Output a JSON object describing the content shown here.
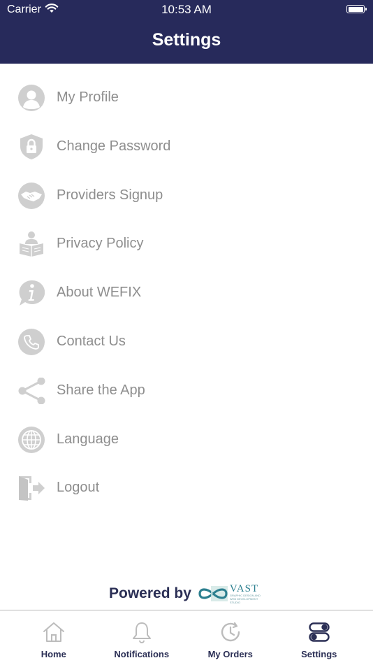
{
  "status_bar": {
    "carrier": "Carrier",
    "time": "10:53 AM"
  },
  "header": {
    "title": "Settings"
  },
  "menu": [
    {
      "label": "My Profile",
      "icon": "profile-icon"
    },
    {
      "label": "Change Password",
      "icon": "lock-shield-icon"
    },
    {
      "label": "Providers Signup",
      "icon": "handshake-icon"
    },
    {
      "label": "Privacy Policy",
      "icon": "reader-icon"
    },
    {
      "label": "About WEFIX",
      "icon": "info-icon"
    },
    {
      "label": "Contact Us",
      "icon": "phone-icon"
    },
    {
      "label": "Share the App",
      "icon": "share-icon"
    },
    {
      "label": "Language",
      "icon": "globe-icon"
    },
    {
      "label": "Logout",
      "icon": "logout-icon"
    }
  ],
  "footer": {
    "powered_by": "Powered by",
    "vast_logo_text": "VAST",
    "vast_tagline": "GRAPHIC DESIGN AND WEB DEVELOPMENT STUDIO"
  },
  "tabbar": {
    "tabs": [
      {
        "label": "Home",
        "icon": "home-icon"
      },
      {
        "label": "Notifications",
        "icon": "bell-icon"
      },
      {
        "label": "My Orders",
        "icon": "orders-clock-icon"
      },
      {
        "label": "Settings",
        "icon": "toggles-icon",
        "active": true
      }
    ]
  },
  "colors": {
    "header_bg": "#272a5b",
    "icon_gray": "#cfcfcf",
    "label_gray": "#8e8e8e",
    "tab_active": "#2b2f55",
    "tab_inactive": "#bcbcbc"
  }
}
